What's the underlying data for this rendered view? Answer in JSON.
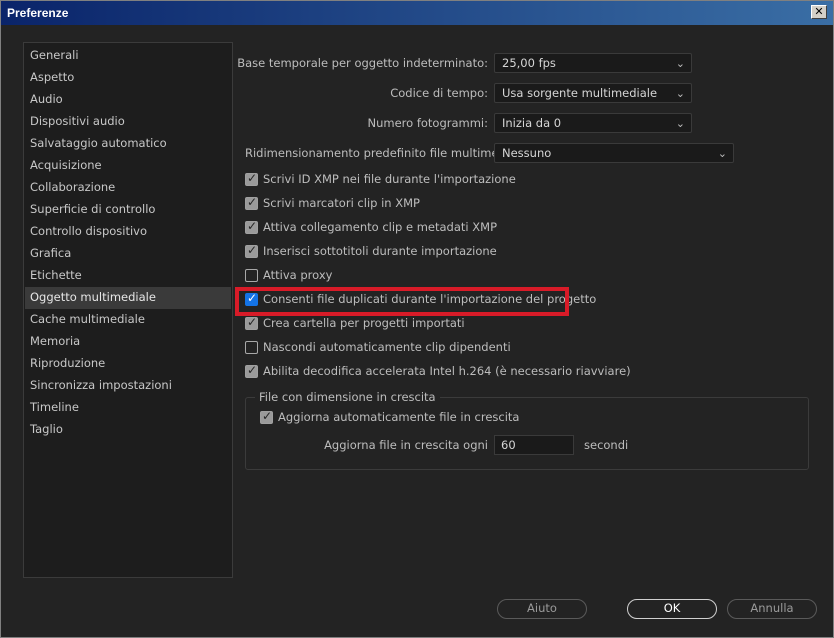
{
  "window": {
    "title": "Preferenze",
    "close_glyph": "✕"
  },
  "sidebar": {
    "items": [
      {
        "label": "Generali"
      },
      {
        "label": "Aspetto"
      },
      {
        "label": "Audio"
      },
      {
        "label": "Dispositivi audio"
      },
      {
        "label": "Salvataggio automatico"
      },
      {
        "label": "Acquisizione"
      },
      {
        "label": "Collaborazione"
      },
      {
        "label": "Superficie di controllo"
      },
      {
        "label": "Controllo dispositivo"
      },
      {
        "label": "Grafica"
      },
      {
        "label": "Etichette"
      },
      {
        "label": "Oggetto multimediale"
      },
      {
        "label": "Cache multimediale"
      },
      {
        "label": "Memoria"
      },
      {
        "label": "Riproduzione"
      },
      {
        "label": "Sincronizza impostazioni"
      },
      {
        "label": "Timeline"
      },
      {
        "label": "Taglio"
      }
    ],
    "selected": "Oggetto multimediale"
  },
  "settings": {
    "base_temporale": {
      "label": "Base temporale per oggetto indeterminato:",
      "value": "25,00  fps"
    },
    "codice_tempo": {
      "label": "Codice di tempo:",
      "value": "Usa sorgente multimediale"
    },
    "numero_fotogrammi": {
      "label": "Numero fotogrammi:",
      "value": "Inizia da 0"
    },
    "ridimensionamento": {
      "label": "Ridimensionamento predefinito file multimediali:",
      "value": "Nessuno"
    }
  },
  "checkboxes": [
    {
      "label": "Scrivi ID XMP nei file durante l'importazione",
      "checked": true
    },
    {
      "label": "Scrivi marcatori clip in XMP",
      "checked": true
    },
    {
      "label": "Attiva collegamento clip e metadati XMP",
      "checked": true
    },
    {
      "label": "Inserisci sottotitoli durante importazione",
      "checked": true
    },
    {
      "label": "Attiva proxy",
      "checked": false
    },
    {
      "label": "Consenti file duplicati durante l'importazione del progetto",
      "checked": true
    },
    {
      "label": "Crea cartella per progetti importati",
      "checked": true
    },
    {
      "label": "Nascondi automaticamente clip dipendenti",
      "checked": false
    },
    {
      "label": "Abilita decodifica accelerata Intel h.264 (è necessario riavviare)",
      "checked": true
    }
  ],
  "growing_files": {
    "title": "File con dimensione in crescita",
    "auto_refresh": {
      "label": "Aggiorna automaticamente file in crescita",
      "checked": true
    },
    "interval_label": "Aggiorna file in crescita ogni",
    "interval_value": "60",
    "interval_unit": "secondi"
  },
  "buttons": {
    "help": "Aiuto",
    "ok": "OK",
    "cancel": "Annulla"
  },
  "colors": {
    "highlight": "#d81b28",
    "checkbox_active": "#1473e6"
  }
}
